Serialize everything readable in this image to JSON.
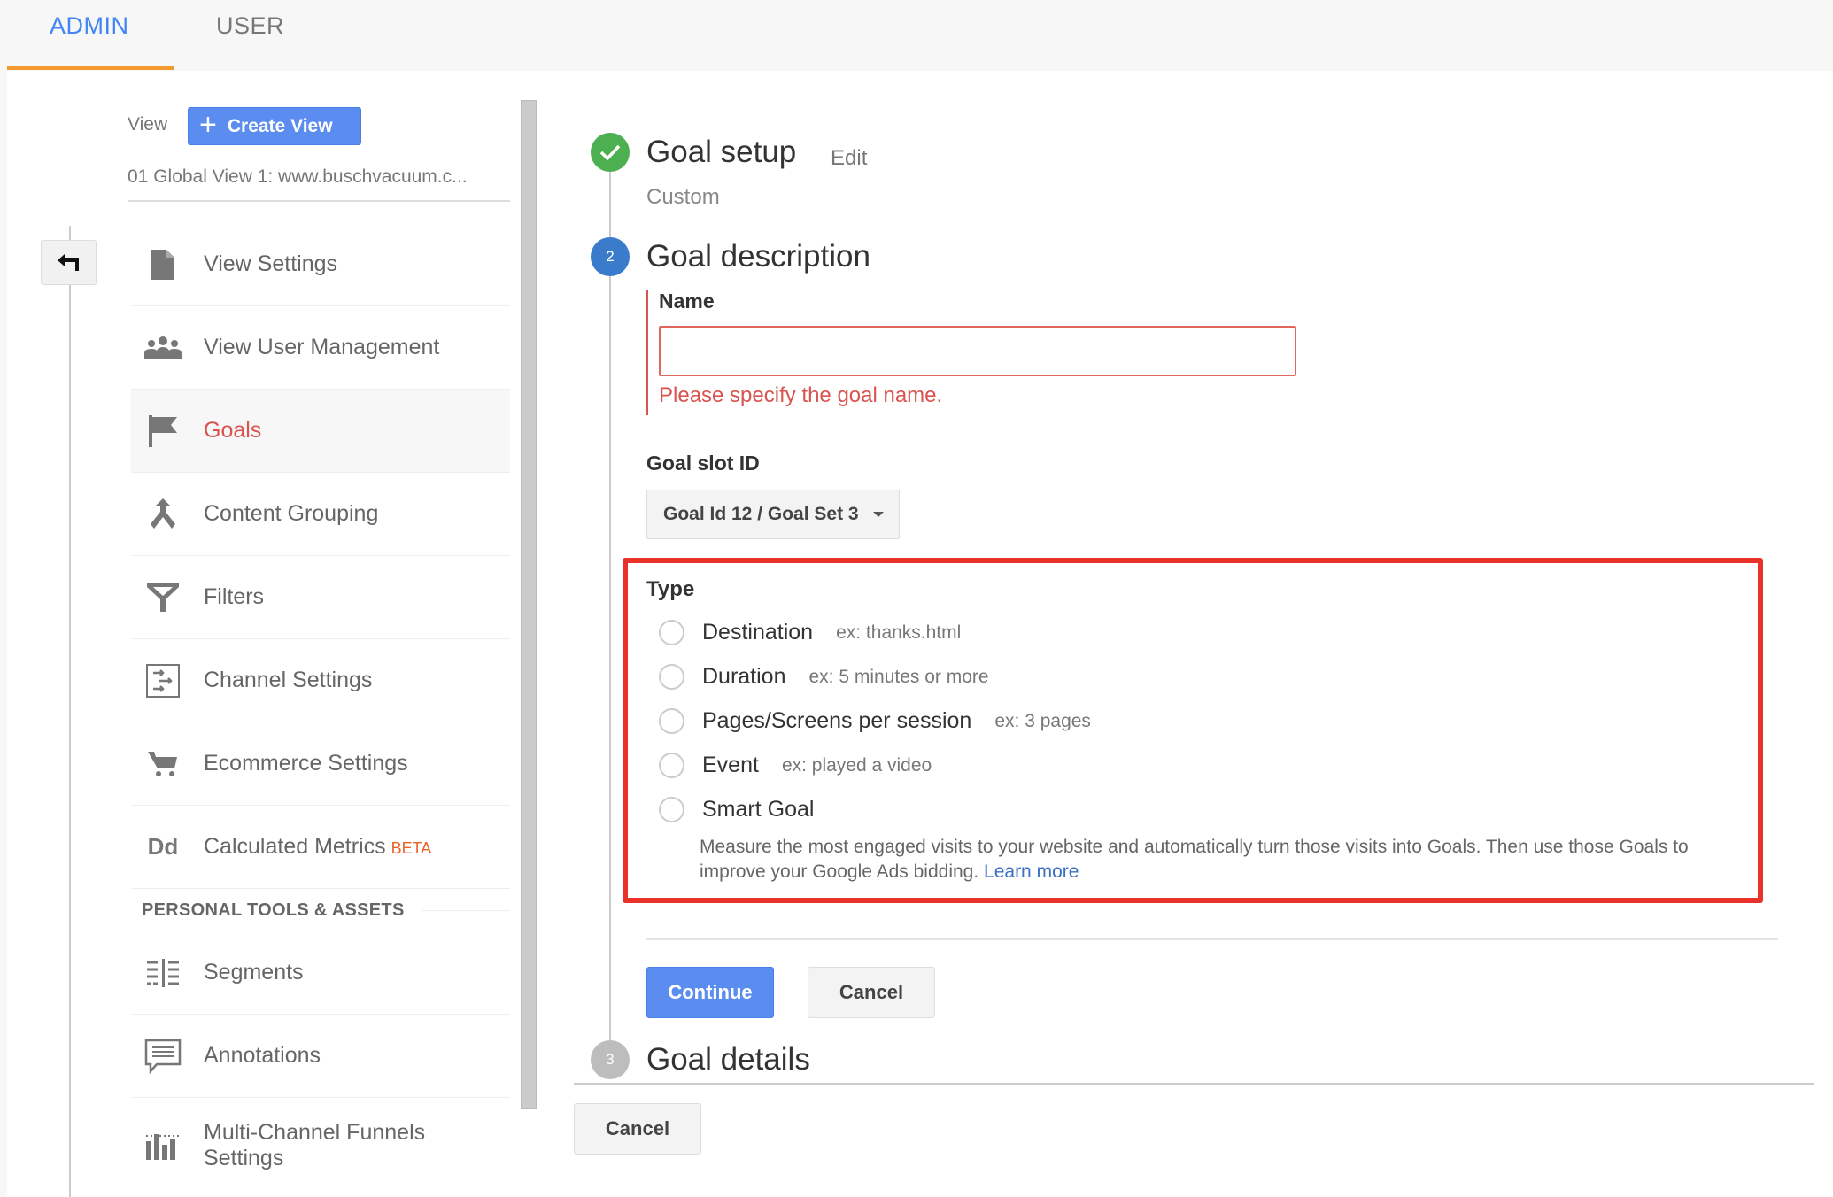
{
  "tabs": [
    {
      "label": "ADMIN",
      "active": true
    },
    {
      "label": "USER",
      "active": false
    }
  ],
  "colors": {
    "accent_blue": "#4285f4",
    "tab_underline": "#f39a31",
    "error_red": "#d9534f",
    "highlight_red": "#e8322a",
    "step_done": "#4caf50",
    "step_current": "#3a7ccb",
    "step_pending": "#bdbdbd"
  },
  "sidebar": {
    "view_label": "View",
    "create_view_label": "Create View",
    "selected_view": "01 Global View 1: www.buschvacuum.c...",
    "items": [
      {
        "label": "View Settings",
        "icon": "document-icon"
      },
      {
        "label": "View User Management",
        "icon": "people-icon"
      },
      {
        "label": "Goals",
        "icon": "flag-icon",
        "active": true
      },
      {
        "label": "Content Grouping",
        "icon": "merge-icon"
      },
      {
        "label": "Filters",
        "icon": "filter-icon"
      },
      {
        "label": "Channel Settings",
        "icon": "channel-icon"
      },
      {
        "label": "Ecommerce Settings",
        "icon": "cart-icon"
      },
      {
        "label": "Calculated Metrics",
        "badge": "BETA",
        "icon": "dd-icon"
      }
    ],
    "section_title": "PERSONAL TOOLS & ASSETS",
    "personal_items": [
      {
        "label": "Segments",
        "icon": "segments-icon"
      },
      {
        "label": "Annotations",
        "icon": "annotation-icon"
      },
      {
        "label": "Multi-Channel Funnels Settings",
        "icon": "bar-chart-icon"
      }
    ]
  },
  "steps": {
    "step1": {
      "title": "Goal setup",
      "edit_label": "Edit",
      "subtitle": "Custom",
      "status": "done"
    },
    "step2": {
      "number": "2",
      "title": "Goal description",
      "status": "current"
    },
    "step3": {
      "number": "3",
      "title": "Goal details",
      "status": "pending"
    }
  },
  "form": {
    "name_label": "Name",
    "name_value": "",
    "name_placeholder": "",
    "name_error": "Please specify the goal name.",
    "slot_label": "Goal slot ID",
    "slot_value": "Goal Id 12 / Goal Set 3",
    "type_label": "Type",
    "types": [
      {
        "label": "Destination",
        "example": "ex: thanks.html",
        "checked": false
      },
      {
        "label": "Duration",
        "example": "ex: 5 minutes or more",
        "checked": false
      },
      {
        "label": "Pages/Screens per session",
        "example": "ex: 3 pages",
        "checked": false
      },
      {
        "label": "Event",
        "example": "ex: played a video",
        "checked": false
      },
      {
        "label": "Smart Goal",
        "example": "",
        "checked": false
      }
    ],
    "smart_goal_desc": "Measure the most engaged visits to your website and automatically turn those visits into Goals. Then use those Goals to improve your Google Ads bidding.",
    "learn_more": "Learn more",
    "continue_label": "Continue",
    "cancel_label": "Cancel"
  },
  "footer": {
    "cancel_label": "Cancel"
  }
}
